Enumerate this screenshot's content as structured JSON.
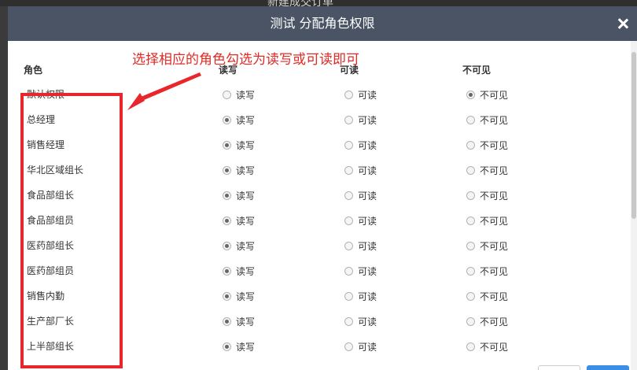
{
  "background": {
    "title": "新建成交订单"
  },
  "dialog": {
    "title": "测试 分配角色权限",
    "close_label": "×",
    "annotation": "选择相应的角色勾选为读写或可读即可",
    "columns": {
      "role": "角色",
      "rw": "读写",
      "read": "可读",
      "hidden": "不可见"
    },
    "option_labels": {
      "rw": "读写",
      "read": "可读",
      "hidden": "不可见"
    },
    "roles": [
      {
        "name": "默认权限",
        "selected": "hidden"
      },
      {
        "name": "总经理",
        "selected": "rw"
      },
      {
        "name": "销售经理",
        "selected": "rw"
      },
      {
        "name": "华北区域组长",
        "selected": "rw"
      },
      {
        "name": "食品部组长",
        "selected": "rw"
      },
      {
        "name": "食品部组员",
        "selected": "rw"
      },
      {
        "name": "医药部组长",
        "selected": "rw"
      },
      {
        "name": "医药部组员",
        "selected": "rw"
      },
      {
        "name": "销售内勤",
        "selected": "rw"
      },
      {
        "name": "生产部厂长",
        "selected": "rw"
      },
      {
        "name": "上半部组长",
        "selected": "rw"
      }
    ]
  },
  "colors": {
    "header": "#4a5464",
    "annotation": "#e8262b"
  }
}
